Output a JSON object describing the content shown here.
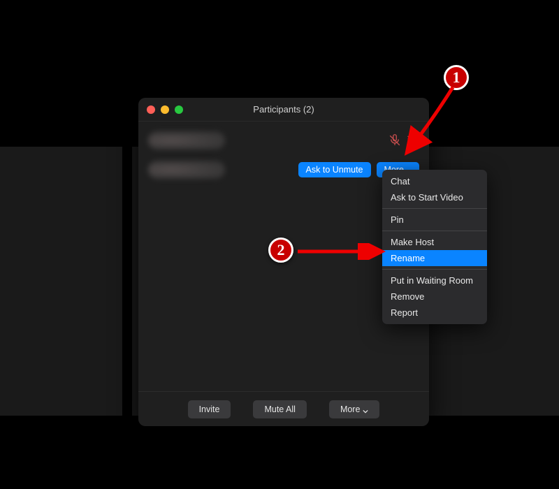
{
  "window": {
    "title": "Participants (2)"
  },
  "participants": {
    "row1": {
      "muted": true,
      "video_off": true
    },
    "row2": {
      "ask_unmute_label": "Ask to Unmute",
      "more_label": "More"
    }
  },
  "menu": {
    "chat": "Chat",
    "ask_video": "Ask to Start Video",
    "pin": "Pin",
    "make_host": "Make Host",
    "rename": "Rename",
    "waiting_room": "Put in Waiting Room",
    "remove": "Remove",
    "report": "Report"
  },
  "footer": {
    "invite": "Invite",
    "mute_all": "Mute All",
    "more": "More"
  },
  "annotations": {
    "one": "1",
    "two": "2"
  }
}
